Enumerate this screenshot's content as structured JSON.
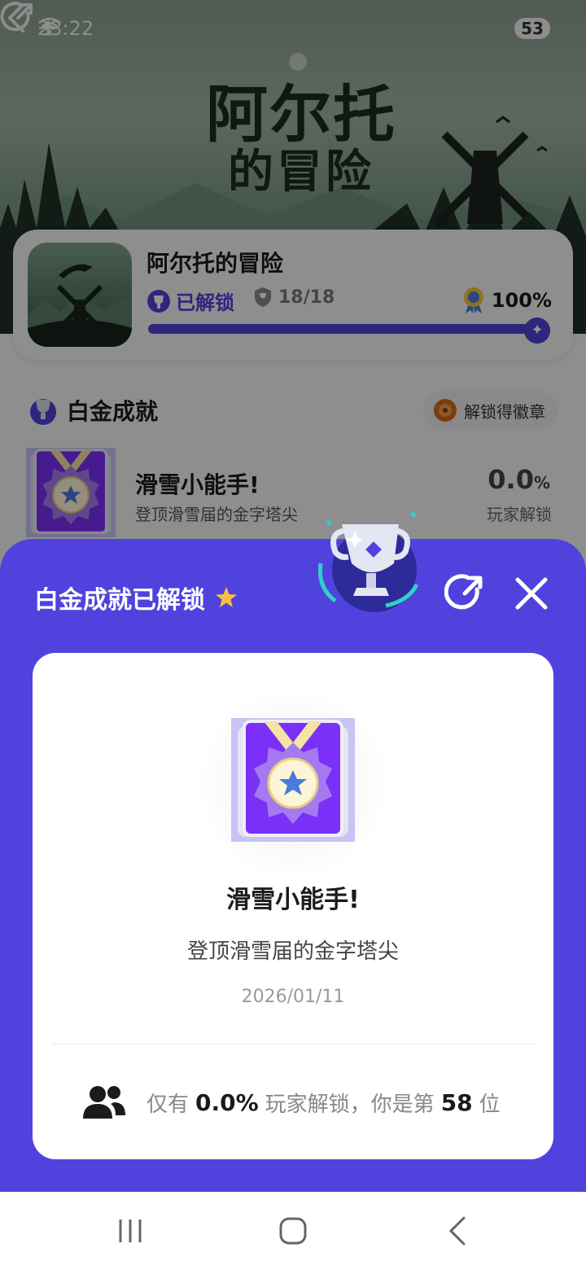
{
  "status_bar": {
    "time": "23:22",
    "battery": "53"
  },
  "hero": {
    "title_line1": "阿尔托",
    "title_line2": "的冒险"
  },
  "game": {
    "name": "阿尔托的冒险",
    "unlock_label": "已解锁",
    "count": "18/18",
    "percent": "100%",
    "progress": 1.0
  },
  "section": {
    "title": "白金成就",
    "badge_button": "解锁得徽章"
  },
  "achievement_row": {
    "title": "滑雪小能手!",
    "desc": "登顶滑雪届的金字塔尖",
    "pct_value": "0.0",
    "pct_unit": "%",
    "pct_label": "玩家解锁"
  },
  "sheet": {
    "title": "白金成就已解锁",
    "achievement_title": "滑雪小能手!",
    "achievement_desc": "登顶滑雪届的金字塔尖",
    "date": "2026/01/11",
    "stat_prefix": "仅有",
    "stat_pct": "0.0%",
    "stat_middle": "玩家解锁，你是第",
    "stat_rank": "58",
    "stat_suffix": "位"
  },
  "colors": {
    "accent": "#5043dd",
    "medal_purple": "#7b2ff7",
    "medal_bg": "#c7c3f5"
  },
  "icons": [
    "back-icon",
    "share-icon",
    "trophy-icon",
    "star-icon",
    "close-icon",
    "people-icon",
    "badge-icon",
    "medal-icon"
  ]
}
